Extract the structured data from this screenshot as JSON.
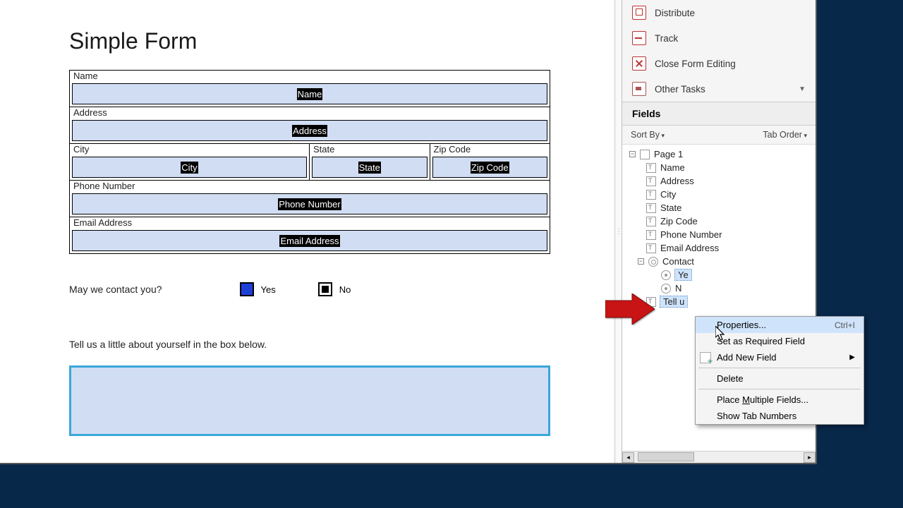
{
  "form": {
    "title": "Simple Form",
    "fields": {
      "name": {
        "label": "Name",
        "tag": "Name"
      },
      "address": {
        "label": "Address",
        "tag": "Address"
      },
      "city": {
        "label": "City",
        "tag": "City"
      },
      "state": {
        "label": "State",
        "tag": "State"
      },
      "zip": {
        "label": "Zip Code",
        "tag": "Zip Code"
      },
      "phone": {
        "label": "Phone Number",
        "tag": "Phone Number"
      },
      "email": {
        "label": "Email Address",
        "tag": "Email Address"
      }
    },
    "question": "May we contact you?",
    "options": {
      "yes": "Yes",
      "no": "No"
    },
    "instruction": "Tell us a little about yourself in the box below."
  },
  "sidebar": {
    "tools": {
      "distribute": "Distribute",
      "track": "Track",
      "close": "Close Form Editing",
      "other": "Other Tasks"
    },
    "fields_header": "Fields",
    "sort_by": "Sort By",
    "tab_order": "Tab Order",
    "tree": {
      "page": "Page 1",
      "items": [
        "Name",
        "Address",
        "City",
        "State",
        "Zip Code",
        "Phone Number",
        "Email Address"
      ],
      "contact": "Contact",
      "contact_children": [
        "Ye",
        "N"
      ],
      "tell_us": "Tell u"
    }
  },
  "context_menu": {
    "properties": "Properties...",
    "properties_shortcut": "Ctrl+I",
    "set_required": "Set as Required Field",
    "add_new": "Add New Field",
    "delete": "Delete",
    "place_multiple_pre": "Place ",
    "place_multiple_u": "M",
    "place_multiple_post": "ultiple Fields...",
    "show_tab": "Show Tab Numbers"
  }
}
